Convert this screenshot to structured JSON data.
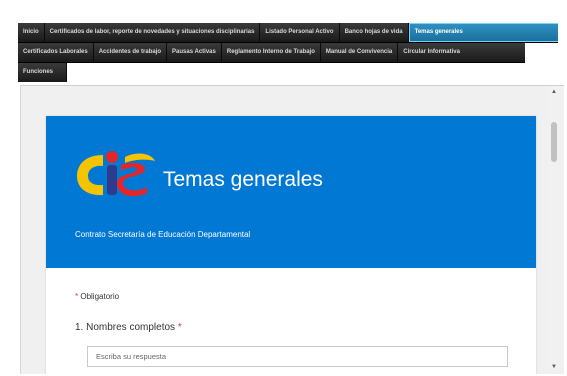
{
  "nav": {
    "row1": [
      "Inicio",
      "Certificados de labor, reporte de novedades y situaciones disciplinarias",
      "Listado Personal Activo",
      "Banco hojas de vida",
      "Temas generales"
    ],
    "row2": [
      "Certificados Laborales",
      "Accidentes de trabajo",
      "Pausas Activas",
      "Reglamento Interno de Trabajo",
      "Manual de Convivencia",
      "Circular Informativa"
    ],
    "row3": [
      "Funciones"
    ],
    "active": "Temas generales"
  },
  "form": {
    "title": "Temas generales",
    "subtitle": "Contrato Secretaría de Educación Departamental",
    "required_star": "*",
    "required_label": "Obligatorio",
    "question1": {
      "label": "1. Nombres completos",
      "required_star": "*",
      "placeholder": "Escriba su respuesta"
    }
  },
  "colors": {
    "header_blue": "#0078d4",
    "active_tab": "#2385b8",
    "required_red": "#d13438",
    "logo_yellow": "#f5c400",
    "logo_red": "#e3262a",
    "logo_blue": "#2e3a8c"
  },
  "icons": [
    "logo-icon",
    "scroll-up-icon",
    "scroll-down-icon"
  ]
}
